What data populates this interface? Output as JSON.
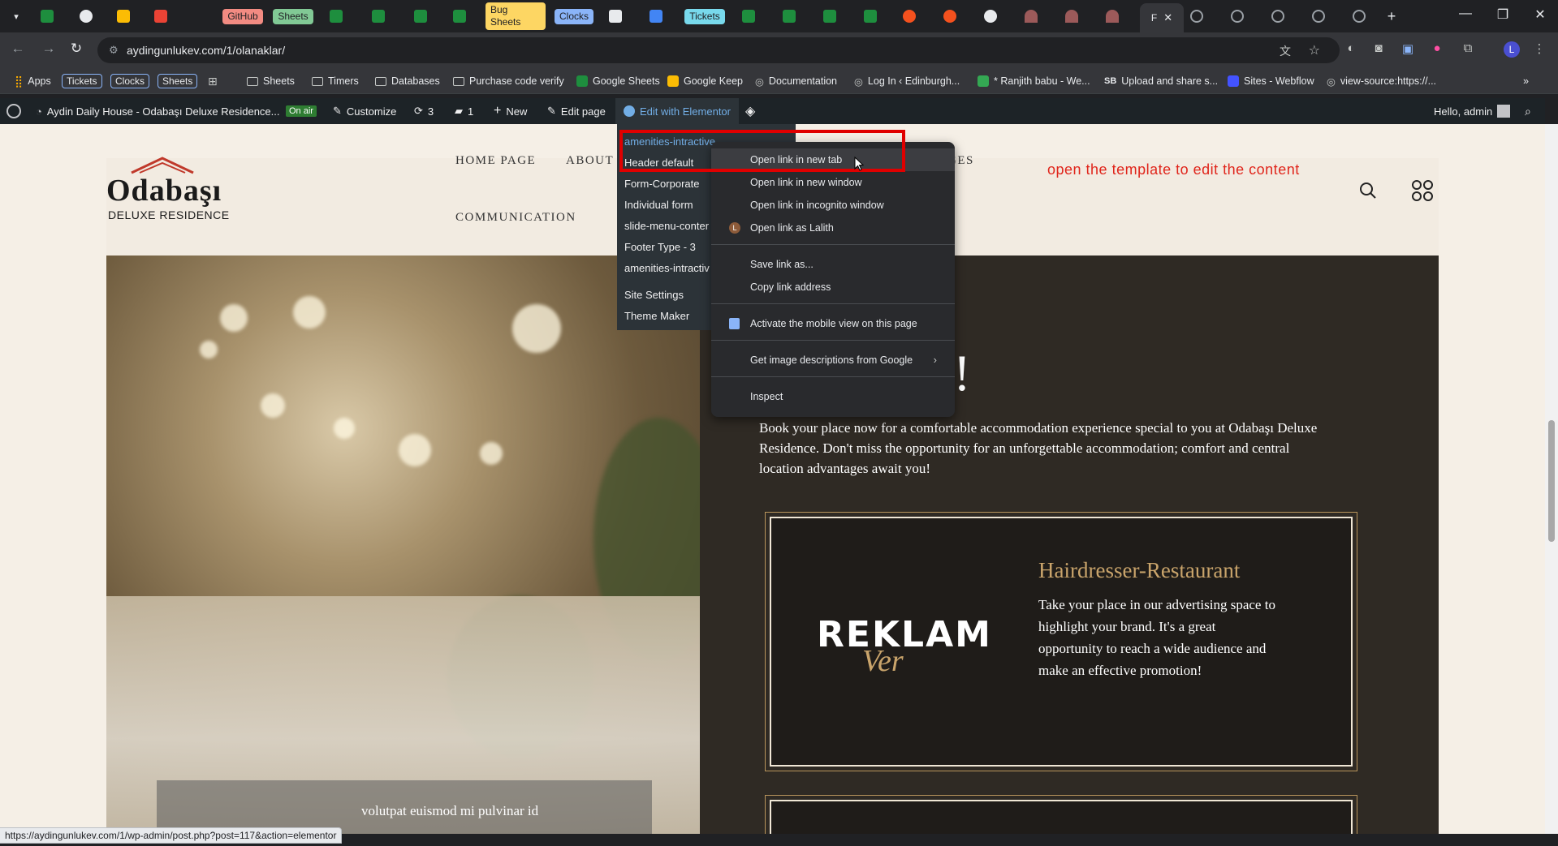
{
  "tabs": {
    "chips": [
      "GitHub",
      "Sheets",
      "Bug Sheets",
      "Clocks",
      "Tickets"
    ],
    "active_label": "F"
  },
  "toolbar": {
    "url": "aydingunlukev.com/1/olanaklar/"
  },
  "bookmarks": {
    "apps": "Apps",
    "tickets": "Tickets",
    "clocks": "Clocks",
    "sheets_chip": "Sheets",
    "sheets": "Sheets",
    "timers": "Timers",
    "databases": "Databases",
    "purchase": "Purchase code verify",
    "google_sheets": "Google Sheets",
    "google_keep": "Google Keep",
    "documentation": "Documentation",
    "login": "Log In ‹ Edinburgh...",
    "ranjith": "* Ranjith babu - We...",
    "upload": "Upload and share s...",
    "webflow": "Sites - Webflow",
    "viewsource": "view-source:https://..."
  },
  "adminbar": {
    "site_title": "Aydin Daily House - Odabaşı Deluxe Residence...",
    "on_air": "On air",
    "customize": "Customize",
    "updates": "3",
    "comments": "1",
    "new": "New",
    "edit_page": "Edit page",
    "edit_elementor": "Edit with Elementor",
    "hello": "Hello, admin"
  },
  "site": {
    "logo_word": "Odabaşı",
    "logo_sub": "DELUXE RESIDENCE",
    "nav": {
      "home": "HOME PAGE",
      "about": "ABOUT",
      "ges": "GES",
      "communication": "COMMUNICATION"
    },
    "annotation": "open the template to edit the content",
    "title_fragment": "w!",
    "intro": "Book your place now for a comfortable accommodation experience special to you at Odabaşı Deluxe Residence. Don't miss the opportunity for an unforgettable accommodation; comfort and central location advantages await you!",
    "card": {
      "logo_main": "REKLAM",
      "logo_script": "Ver",
      "title": "Hairdresser-Restaurant",
      "body": "Take your place in our advertising space to highlight your brand. It's a great opportunity to reach a wide audience and make an effective promotion!"
    },
    "photo_caption": "volutpat euismod mi pulvinar id"
  },
  "elementor_menu": [
    "amenities-intractive",
    "Header default",
    "Form-Corporate",
    "Individual form",
    "slide-menu-conter",
    "Footer Type - 3",
    "amenities-intractiv",
    "Site Settings",
    "Theme Maker"
  ],
  "context_menu": {
    "open_new_tab": "Open link in new tab",
    "open_new_window": "Open link in new window",
    "open_incognito": "Open link in incognito window",
    "open_as": "Open link as Lalith",
    "save_link": "Save link as...",
    "copy_link": "Copy link address",
    "mobile_view": "Activate the mobile view on this page",
    "image_desc": "Get image descriptions from Google",
    "inspect": "Inspect",
    "avatar_letter": "L"
  },
  "status_url": "https://aydingunlukev.com/1/wp-admin/post.php?post=117&action=elementor",
  "colors": {
    "annotation": "#e0251b",
    "accent_gold": "#c9a46b",
    "elementor_blue": "#72aee6"
  }
}
